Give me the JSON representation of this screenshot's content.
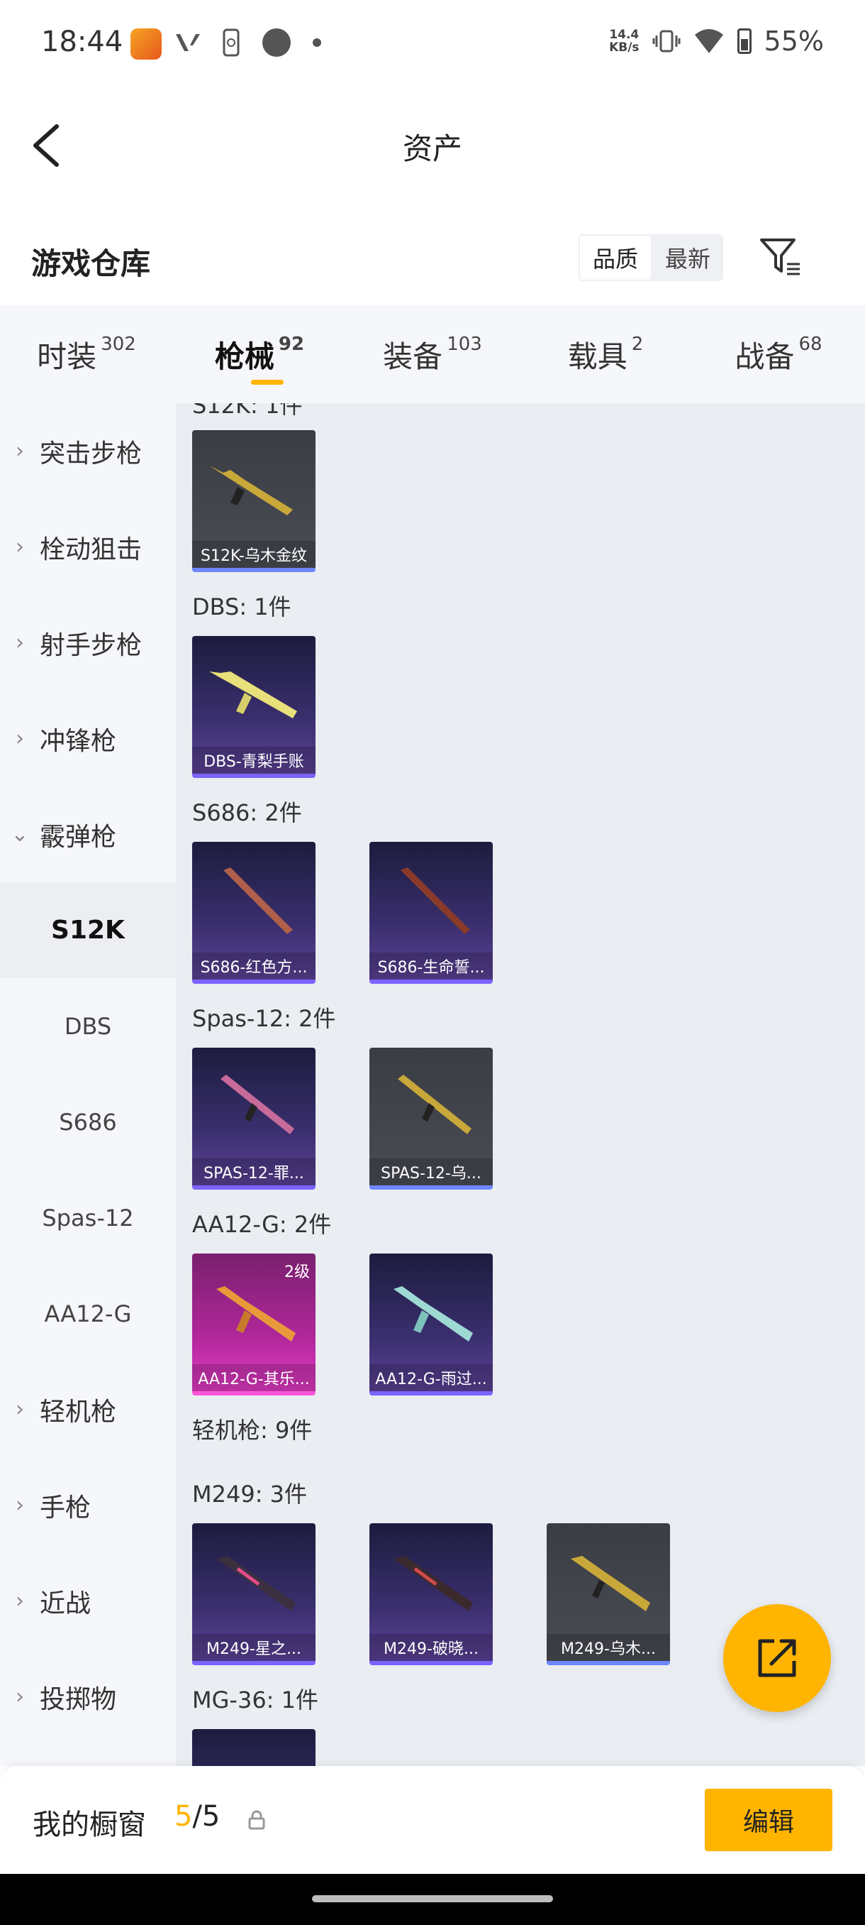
{
  "status_bar": {
    "time": "18:44",
    "net_speed_value": "14.4",
    "net_speed_unit": "KB/s",
    "battery": "55%"
  },
  "header": {
    "title": "资产"
  },
  "warehouse": {
    "title": "游戏仓库",
    "sort_options": [
      "品质",
      "最新"
    ],
    "active_sort": "品质"
  },
  "tabs": [
    {
      "label": "时装",
      "count": "302"
    },
    {
      "label": "枪械",
      "count": "92"
    },
    {
      "label": "装备",
      "count": "103"
    },
    {
      "label": "载具",
      "count": "2"
    },
    {
      "label": "战备",
      "count": "68"
    }
  ],
  "sidebar": {
    "categories_top": [
      "突击步枪",
      "栓动狙击",
      "射手步枪",
      "冲锋枪",
      "霰弹枪"
    ],
    "subitems": [
      "S12K",
      "DBS",
      "S686",
      "Spas-12",
      "AA12-G"
    ],
    "categories_bottom": [
      "轻机枪",
      "手枪",
      "近战",
      "投掷物"
    ]
  },
  "content": {
    "partial_header": "S12K: 1件",
    "sections": [
      {
        "label": "DBS: 1件"
      },
      {
        "label": "S686: 2件"
      },
      {
        "label": "Spas-12: 2件"
      },
      {
        "label": "AA12-G: 2件"
      },
      {
        "label": "轻机枪: 9件"
      },
      {
        "label": "M249: 3件"
      },
      {
        "label": "MG-36: 1件"
      }
    ],
    "cards": [
      {
        "name": "S12K-乌木金纹"
      },
      {
        "name": "DBS-青梨手账"
      },
      {
        "name": "S686-红色方..."
      },
      {
        "name": "S686-生命誓..."
      },
      {
        "name": "SPAS-12-罪..."
      },
      {
        "name": "SPAS-12-乌..."
      },
      {
        "name": "AA12-G-其乐...",
        "level": "2级"
      },
      {
        "name": "AA12-G-雨过..."
      },
      {
        "name": "M249-星之..."
      },
      {
        "name": "M249-破晓..."
      },
      {
        "name": "M249-乌木..."
      }
    ]
  },
  "bottom_bar": {
    "label": "我的橱窗",
    "current": "5",
    "total": "/5",
    "edit_label": "编辑"
  },
  "colors": {
    "accent": "#ffb400",
    "rarity_purple": "#7b63ff",
    "rarity_pink": "#ff57d8",
    "rarity_grey": "#6e86ff"
  },
  "icons": [
    "back-arrow-icon",
    "filter-icon",
    "share-export-icon",
    "lock-icon",
    "chevron-right-icon",
    "chevron-down-icon"
  ]
}
